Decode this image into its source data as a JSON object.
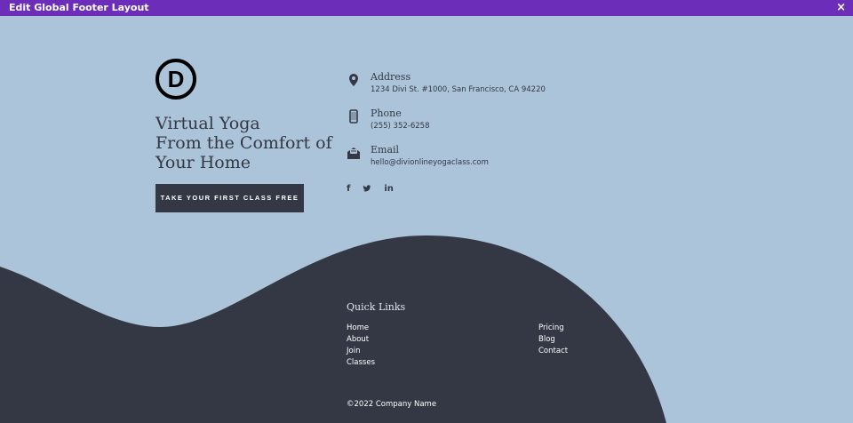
{
  "window": {
    "title": "Edit Global Footer Layout",
    "close_icon": "×"
  },
  "brand": {
    "logo_letter": "D",
    "headline": [
      "Virtual Yoga",
      "From the Comfort of",
      "Your Home"
    ],
    "cta": "TAKE YOUR FIRST CLASS FREE"
  },
  "contact": [
    {
      "icon": "map-pin-icon",
      "label": "Address",
      "value": "1234 Divi St. #1000, San Francisco, CA 94220"
    },
    {
      "icon": "phone-icon",
      "label": "Phone",
      "value": "(255) 352-6258"
    },
    {
      "icon": "envelope-open-icon",
      "label": "Email",
      "value": "hello@divionlineyogaclass.com"
    }
  ],
  "social": {
    "facebook": "f",
    "twitter": "🐦",
    "linkedin": "in"
  },
  "footer": {
    "quick_links_title": "Quick Links",
    "col1": [
      "Home",
      "About",
      "Join",
      "Classes"
    ],
    "col2": [
      "Pricing",
      "Blog",
      "Contact"
    ],
    "copyright": "©2022 Company Name"
  },
  "colors": {
    "topbar": "#6c2eb9",
    "background": "#abc4d9",
    "dark": "#333844"
  }
}
